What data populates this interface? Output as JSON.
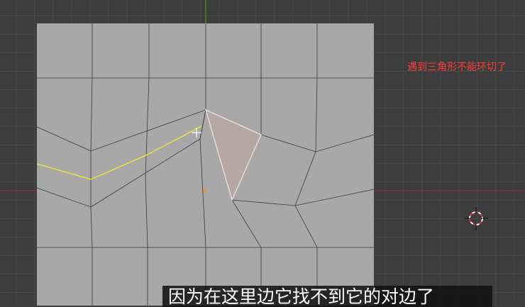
{
  "viewport": {
    "background_color": "#3d3d3d",
    "grid_color": "#474747",
    "axis_x_color": "#8c2d36",
    "axis_y_color": "#5c8a2a",
    "mesh_face_color": "#a8a8a8",
    "mesh_wire_color": "#3a3a3a",
    "selected_face_color": "#b6a6a4",
    "selected_edge_color": "#e8e0dc",
    "loop_cut_preview_color": "#e6e63a",
    "origin_color": "#ff8a00"
  },
  "annotation": {
    "text": "遇到三角形不能环切了",
    "color": "#ff3a3a"
  },
  "subtitle": {
    "text": "因为在这里边它找不到它的对边了"
  },
  "icons": {
    "cursor": "crosshair-cursor-icon",
    "cursor_3d": "3d-cursor-icon",
    "origin": "object-origin-icon"
  }
}
